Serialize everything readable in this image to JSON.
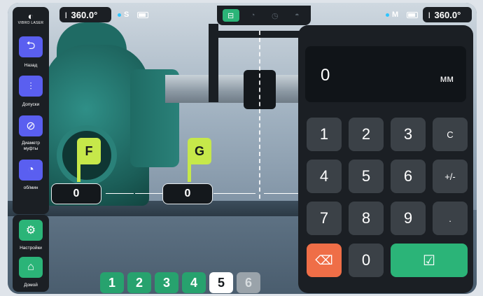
{
  "app": {
    "logo_text": "VIBRO LASER"
  },
  "status_left": {
    "angle": "360.0°",
    "unit_label": "S"
  },
  "status_right": {
    "unit_label": "M",
    "angle": "360.0°"
  },
  "sidebar": {
    "items": [
      {
        "label": "Назад",
        "icon": "back-arrow-icon"
      },
      {
        "label": "Допуски",
        "icon": "tolerance-icon"
      },
      {
        "label": "Диаметр муфты",
        "icon": "diameter-icon"
      },
      {
        "label": "об/мин",
        "icon": "rpm-gauge-icon"
      }
    ],
    "bottom": [
      {
        "label": "Настройки",
        "icon": "settings-icon"
      },
      {
        "label": "Домой",
        "icon": "home-icon"
      }
    ]
  },
  "measurements": [
    {
      "tag": "F",
      "value": "0"
    },
    {
      "tag": "G",
      "value": "0"
    }
  ],
  "steps": {
    "labels": [
      "1",
      "2",
      "3",
      "4",
      "5",
      "6"
    ],
    "current": "5",
    "disabled": [
      "6"
    ]
  },
  "keypad": {
    "display_value": "0",
    "unit": "мм",
    "keys": [
      "1",
      "2",
      "3",
      "C",
      "4",
      "5",
      "6",
      "+/-",
      "7",
      "8",
      "9",
      ".",
      "0"
    ]
  },
  "colors": {
    "accent_green": "#2bb478",
    "accent_blue": "#5a5ff0",
    "tag_yellow": "#c6e84a",
    "delete_orange": "#ef6e47"
  }
}
